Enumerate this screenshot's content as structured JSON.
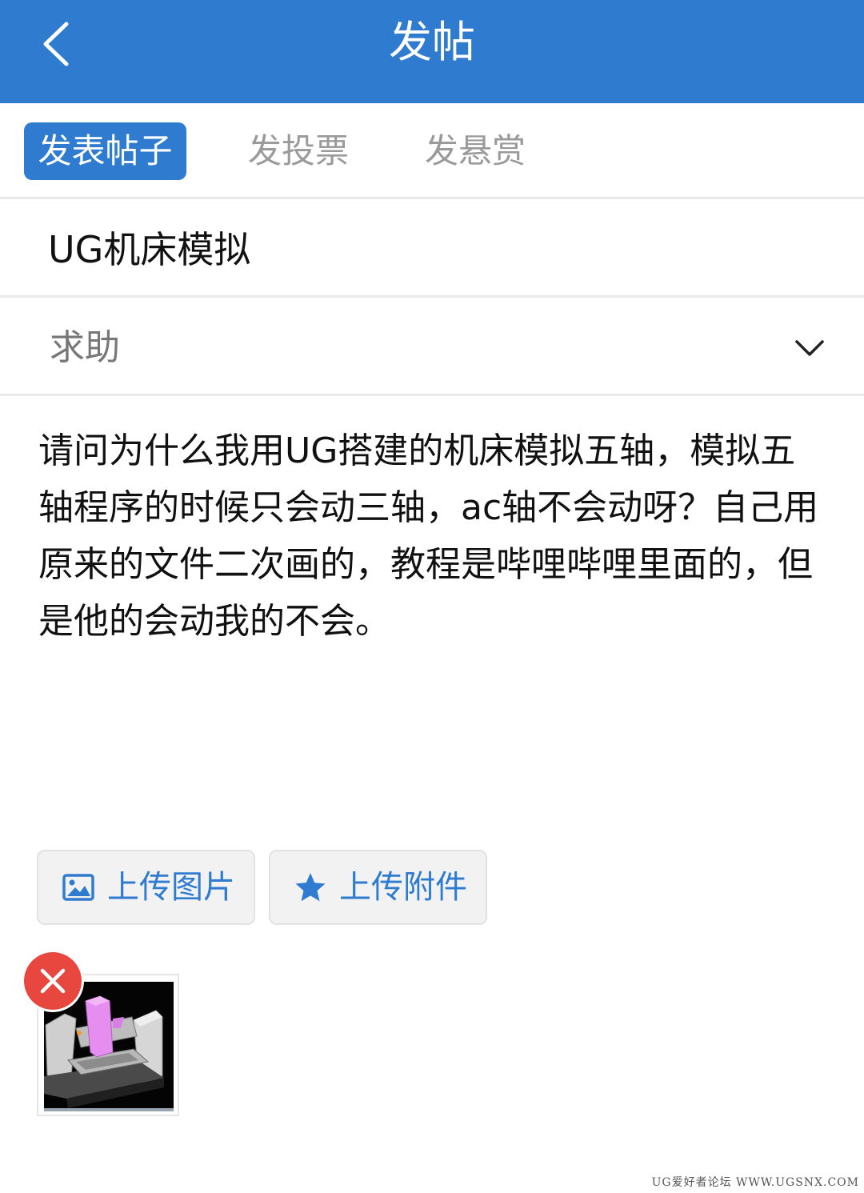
{
  "header": {
    "title": "发帖",
    "back_icon": "chevron-left-icon"
  },
  "tabs": [
    {
      "label": "发表帖子",
      "active": true
    },
    {
      "label": "发投票",
      "active": false
    },
    {
      "label": "发悬赏",
      "active": false
    }
  ],
  "form": {
    "title_value": "UG机床模拟",
    "category_value": "求助",
    "content_value": "请问为什么我用UG搭建的机床模拟五轴，模拟五轴程序的时候只会动三轴，ac轴不会动呀？自己用原来的文件二次画的，教程是哔哩哔哩里面的，但是他的会动我的不会。"
  },
  "uploads": {
    "image_label": "上传图片",
    "image_icon": "image-icon",
    "file_label": "上传附件",
    "file_icon": "star-icon"
  },
  "attachment": {
    "remove_icon": "close-icon"
  },
  "watermark": "UG爱好者论坛 WWW.UGSNX.COM",
  "colors": {
    "primary": "#2f7bd0",
    "remove": "#e8473f",
    "tab_inactive": "#9a9a9a"
  }
}
